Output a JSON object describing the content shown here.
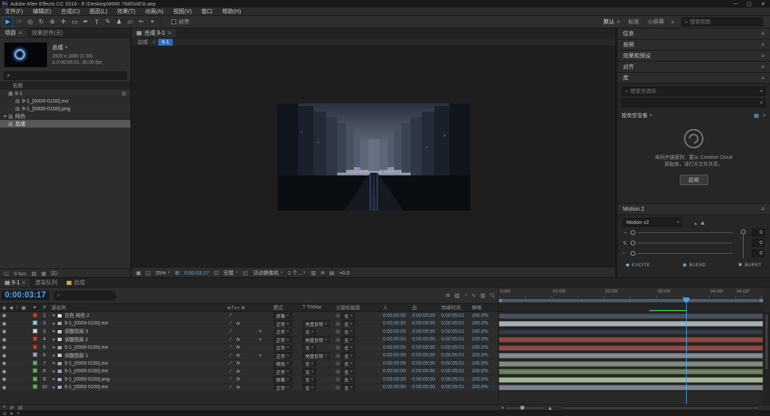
{
  "glyphs": {
    "search": "⌕",
    "menu": "≡",
    "dropdown": "∨",
    "dropdown_small": "▾",
    "twirl_closed": "▶",
    "eye": "◉",
    "audio": "◀",
    "solo": "○",
    "lock": "▣",
    "label": "●",
    "hash": "#",
    "pickwhip": "◎",
    "slash": "⁄",
    "fx": "fx",
    "adj": "◐",
    "minimize": "—",
    "maximize": "▢",
    "close": "✕",
    "overflow": "»",
    "icon_comp": "▦",
    "icon_footage": "▤",
    "icon_folder": "▨",
    "switches_header": "♦⁄fx◐⊕",
    "mountain": "▲",
    "grid_view": "▦",
    "list_view": "≡"
  },
  "titlebar": {
    "app_initials": "Ae",
    "title": "Adobe After Effects CC 2018 - E:\\Desktop\\8680 7680\\AE\\9.aep"
  },
  "menubar": {
    "items": [
      {
        "name": "file",
        "label": "文件(F)"
      },
      {
        "name": "edit",
        "label": "编辑(E)"
      },
      {
        "name": "composition",
        "label": "合成(C)"
      },
      {
        "name": "layer",
        "label": "图层(L)"
      },
      {
        "name": "effect",
        "label": "效果(T)"
      },
      {
        "name": "animation",
        "label": "动画(A)"
      },
      {
        "name": "view",
        "label": "视图(V)"
      },
      {
        "name": "window",
        "label": "窗口"
      },
      {
        "name": "help",
        "label": "帮助(H)"
      }
    ]
  },
  "toolbar": {
    "tools": [
      {
        "name": "selection-tool-icon",
        "glyph": "▶",
        "active": true
      },
      {
        "name": "hand-tool-icon",
        "glyph": "☞"
      },
      {
        "name": "zoom-tool-icon",
        "glyph": "◎"
      },
      {
        "name": "rotation-tool-icon",
        "glyph": "↻"
      },
      {
        "name": "camera-tool-icon",
        "glyph": "⊛"
      },
      {
        "name": "pan-behind-tool-icon",
        "glyph": "✛"
      },
      {
        "name": "shape-tool-icon",
        "glyph": "▭"
      },
      {
        "name": "pen-tool-icon",
        "glyph": "✒"
      },
      {
        "name": "type-tool-icon",
        "glyph": "T"
      },
      {
        "name": "brush-tool-icon",
        "glyph": "✎"
      },
      {
        "name": "clone-stamp-tool-icon",
        "glyph": "♟"
      },
      {
        "name": "eraser-tool-icon",
        "glyph": "▱"
      },
      {
        "name": "roto-brush-tool-icon",
        "glyph": "✂"
      },
      {
        "name": "puppet-pin-tool-icon",
        "glyph": "⌖"
      }
    ],
    "snap_label": "对齐",
    "workspaces": [
      {
        "name": "default",
        "label": "默认",
        "active": true
      },
      {
        "name": "standard",
        "label": "标准"
      },
      {
        "name": "small-screen",
        "label": "小屏幕"
      }
    ],
    "search_placeholder": "搜索帮助"
  },
  "project": {
    "tabs": [
      {
        "label": "项目"
      },
      {
        "label": "效果控件(无)"
      }
    ],
    "preview": {
      "comp_name": "总成",
      "info_line1": "1920 x 1080 (1.00)",
      "info_line2": "Δ 0:00:05:01, 30.00 fps"
    },
    "name_column": "名称",
    "items": [
      {
        "name": "comp-9-1",
        "label": "9-1",
        "icon": "comp",
        "indent": 0,
        "badge": true
      },
      {
        "name": "footage-exr",
        "label": "9-1_[0000-0150].exr",
        "icon": "footage",
        "indent": 1
      },
      {
        "name": "footage-png",
        "label": "9-1_[0000-0150].png",
        "icon": "footage",
        "indent": 1
      },
      {
        "name": "folder-solids",
        "label": "纯色",
        "icon": "folder",
        "indent": 0,
        "twirl": true
      },
      {
        "name": "comp-zongcheng",
        "label": "总成",
        "icon": "comp",
        "indent": 0,
        "selected": true
      }
    ],
    "footer_icons": [
      {
        "name": "interpret-footage-icon",
        "glyph": "◱"
      },
      {
        "name": "bit-depth-label",
        "glyph": "8 bpc"
      },
      {
        "name": "new-folder-icon",
        "glyph": "▨"
      },
      {
        "name": "new-comp-icon",
        "glyph": "▦"
      },
      {
        "name": "delete-icon",
        "glyph": "⌦"
      }
    ]
  },
  "viewer": {
    "tab_label": "合成 9-1",
    "crumb": {
      "root": "总成",
      "separator": "《",
      "current": "9-1"
    },
    "controls": {
      "left_icons": [
        {
          "name": "snapshot-icon",
          "glyph": "▣"
        },
        {
          "name": "channels-icon",
          "glyph": "◫"
        }
      ],
      "zoom": "25%",
      "grid_icon": "⊞",
      "time": "0:00:03:17",
      "camera_icon": "⊡",
      "resolution": "完整",
      "roi_icon": "◰",
      "camera": "活动摄像机",
      "views": "1 个...",
      "right_icons": [
        {
          "name": "pixel-aspect-icon",
          "glyph": "▥"
        },
        {
          "name": "fast-preview-icon",
          "glyph": "≋"
        },
        {
          "name": "mini-timeline-icon",
          "glyph": "▤"
        }
      ],
      "exposure": "+0.0"
    }
  },
  "right_column": {
    "collapsed_panels": [
      {
        "name": "info",
        "label": "信息"
      },
      {
        "name": "audio",
        "label": "音频"
      },
      {
        "name": "effects-presets",
        "label": "效果和预设"
      },
      {
        "name": "align",
        "label": "对齐"
      }
    ],
    "library": {
      "title": "库",
      "search_placeholder": "搜索资源库",
      "view_by_label": "按类型查看",
      "message_line1": "库同步链接到：要从 Creative Cloud",
      "message_line2": "获取库，请打开文件共享。",
      "enable_button": "启用"
    },
    "motion": {
      "title": "Motion 2",
      "preset": "Motion v2",
      "params": [
        {
          "name": "motion-param-1",
          "icon": "↔",
          "value": "0"
        },
        {
          "name": "motion-param-2",
          "icon": "⇅",
          "value": "0"
        },
        {
          "name": "motion-param-3",
          "icon": "›",
          "value": "0"
        }
      ],
      "buttons": [
        {
          "name": "excite-button",
          "icon": "◆",
          "label": "EXCITE"
        },
        {
          "name": "blend-button",
          "icon": "◉",
          "label": "BLEND"
        },
        {
          "name": "burst-button",
          "icon": "✱",
          "label": "BURST"
        }
      ]
    }
  },
  "timeline": {
    "tabs": [
      {
        "name": "timeline-9-1",
        "label": "9-1",
        "active": true,
        "icon_color": "#8a97a8"
      },
      {
        "name": "render-queue",
        "label": "渲染队列"
      },
      {
        "name": "timeline-zongcheng",
        "label": "总成",
        "icon_color": "#c9a356"
      }
    ],
    "current_time": "0:00:03:17",
    "right_icons": [
      {
        "name": "comp-mini-flowchart-icon",
        "glyph": "≋"
      },
      {
        "name": "draft-3d-icon",
        "glyph": "▧"
      },
      {
        "name": "hide-shy-icon",
        "glyph": "◔"
      },
      {
        "name": "frame-blend-icon",
        "glyph": "∿"
      },
      {
        "name": "motion-blur-icon",
        "glyph": "▥"
      },
      {
        "name": "graph-editor-icon",
        "glyph": "◹"
      }
    ],
    "columns": {
      "source_name": "源名称",
      "mode": "模式",
      "trkmat": "T TrkMat",
      "parent": "父级和链接",
      "in": "入",
      "out": "出",
      "duration": "持续时间",
      "stretch": "伸缩"
    },
    "ruler_labels": [
      {
        "label": "0:00f",
        "frac": 0
      },
      {
        "label": "01:00f",
        "frac": 0.199
      },
      {
        "label": "02:00f",
        "frac": 0.397
      },
      {
        "label": "03:00f",
        "frac": 0.596
      },
      {
        "label": "04:00f",
        "frac": 0.795
      },
      {
        "label": "04:15f",
        "frac": 0.894
      }
    ],
    "playhead_frac": 0.708,
    "render_bar": {
      "start_frac": 0.57,
      "end_frac": 0.71,
      "color": "#3aa33a"
    },
    "layers": [
      {
        "num": "1",
        "name": "白色 纯色 2",
        "label_color": "#b4433c",
        "icon_color": "#e0e0e0",
        "mode": "屏幕",
        "trkmat": "",
        "parent": "无",
        "t_in": "0:00:00:00",
        "t_out": "0:00:05:00",
        "duration": "0:00:05:01",
        "stretch": "100.0%",
        "fx": false,
        "adj": false,
        "bar_color": "#4a5160"
      },
      {
        "num": "2",
        "name": "9-1_[0000-0150].exr",
        "label_color": "#9fc3cf",
        "icon_color": "#9aa7c0",
        "mode": "正常",
        "trkmat": "亮度反转",
        "parent": "无",
        "t_in": "0:00:00:00",
        "t_out": "0:00:05:00",
        "duration": "0:00:05:01",
        "stretch": "100.0%",
        "fx": true,
        "adj": false,
        "bar_color": "#a9afb7"
      },
      {
        "num": "3",
        "name": "调整图层 3",
        "label_color": "#d8d8d8",
        "icon_color": "#c8c8c8",
        "mode": "正常",
        "trkmat": "无",
        "parent": "无",
        "t_in": "0:00:00:00",
        "t_out": "0:00:05:00",
        "duration": "0:00:05:01",
        "stretch": "100.0%",
        "fx": false,
        "adj": true,
        "bar_color": "#333b47"
      },
      {
        "num": "4",
        "name": "调整图层 2",
        "label_color": "#b4433c",
        "icon_color": "#c8c8c8",
        "mode": "正常",
        "trkmat": "亮度反转",
        "parent": "无",
        "t_in": "0:00:00:00",
        "t_out": "0:00:05:00",
        "duration": "0:00:05:01",
        "stretch": "100.0%",
        "fx": true,
        "adj": true,
        "bar_color": "#8c4c46"
      },
      {
        "num": "5",
        "name": "9-1_[0000-0150].exr",
        "label_color": "#b4433c",
        "icon_color": "#9aa7c0",
        "mode": "正常",
        "trkmat": "无",
        "parent": "无",
        "t_in": "0:00:00:00",
        "t_out": "0:00:05:00",
        "duration": "0:00:05:01",
        "stretch": "100.0%",
        "fx": true,
        "adj": false,
        "bar_color": "#8c4c46"
      },
      {
        "num": "6",
        "name": "调整图层 1",
        "label_color": "#a89ac8",
        "icon_color": "#c8c8c8",
        "mode": "正常",
        "trkmat": "亮度反转",
        "parent": "无",
        "t_in": "0:00:00:00",
        "t_out": "0:00:05:00",
        "duration": "0:00:05:01",
        "stretch": "100.0%",
        "fx": true,
        "adj": true,
        "bar_color": "#84888f"
      },
      {
        "num": "7",
        "name": "9-1_[0000-0150].exr",
        "label_color": "#6fa86f",
        "icon_color": "#9aa7c0",
        "mode": "相加",
        "trkmat": "无",
        "parent": "无",
        "t_in": "0:00:00:00",
        "t_out": "0:00:05:00",
        "duration": "0:00:05:01",
        "stretch": "100.0%",
        "fx": true,
        "adj": false,
        "bar_color": "#7f8b81"
      },
      {
        "num": "8",
        "name": "9-1_[0000-0150].exr",
        "label_color": "#6fa86f",
        "icon_color": "#9aa7c0",
        "mode": "正常",
        "trkmat": "无",
        "parent": "无",
        "t_in": "0:00:00:00",
        "t_out": "0:00:05:00",
        "duration": "0:00:05:01",
        "stretch": "100.0%",
        "fx": true,
        "adj": false,
        "bar_color": "#6f8360"
      },
      {
        "num": "9",
        "name": "9-1_[0000-0150].png",
        "label_color": "#6fa86f",
        "icon_color": "#9aa7c0",
        "mode": "屏幕",
        "trkmat": "无",
        "parent": "无",
        "t_in": "0:00:00:00",
        "t_out": "0:00:05:00",
        "duration": "0:00:05:01",
        "stretch": "100.0%",
        "fx": true,
        "adj": false,
        "bar_color": "#a3b59b"
      },
      {
        "num": "10",
        "name": "9-1_[0000-0150].exr",
        "label_color": "#6fa86f",
        "icon_color": "#9aa7c0",
        "mode": "正常",
        "trkmat": "无",
        "parent": "无",
        "t_in": "0:00:00:00",
        "t_out": "0:00:05:00",
        "duration": "0:00:05:01",
        "stretch": "100.0%",
        "fx": true,
        "adj": false,
        "bar_color": "#7e848c"
      }
    ],
    "bottom_icons": [
      {
        "name": "expand-layers-icon",
        "glyph": "≡"
      },
      {
        "name": "toggle-switches-icon",
        "glyph": "⇄"
      },
      {
        "name": "graph-editor-toggle-icon",
        "glyph": "▤"
      }
    ]
  },
  "statusbar": {
    "icons": [
      {
        "name": "preview-status-icon",
        "glyph": "◍"
      },
      {
        "name": "audio-status-icon",
        "glyph": "◈"
      },
      {
        "name": "render-status-icon",
        "glyph": "✛"
      }
    ]
  }
}
